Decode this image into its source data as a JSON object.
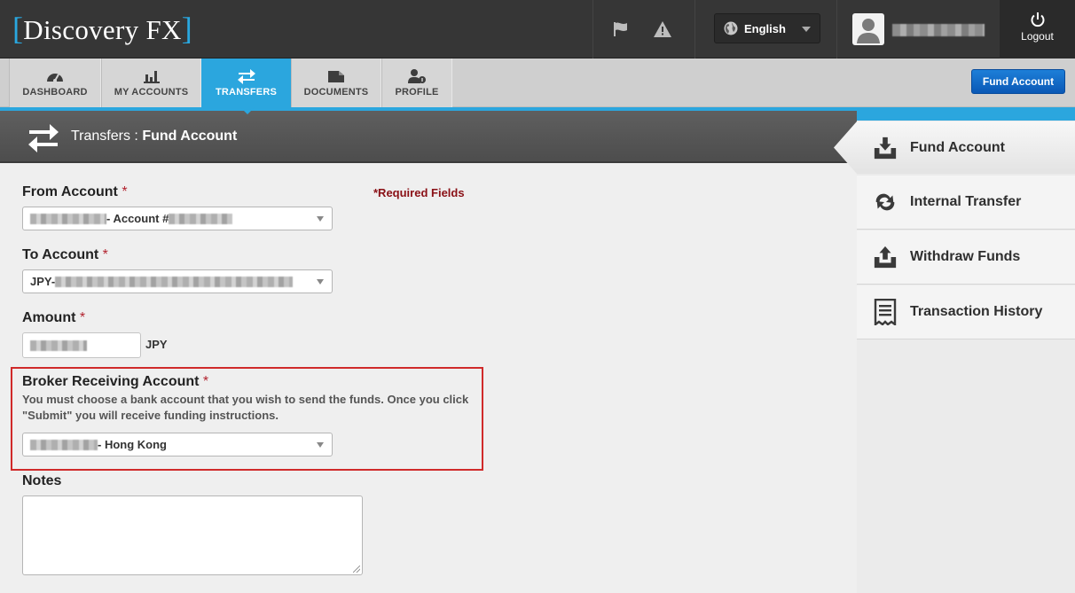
{
  "header": {
    "logo_text": "Discovery FX",
    "language": "English",
    "logout_label": "Logout"
  },
  "nav": {
    "tabs": [
      {
        "label": "DASHBOARD",
        "icon": "dashboard-gauge-icon"
      },
      {
        "label": "MY ACCOUNTS",
        "icon": "bar-chart-icon"
      },
      {
        "label": "TRANSFERS",
        "icon": "transfer-arrows-icon",
        "active": true
      },
      {
        "label": "DOCUMENTS",
        "icon": "folder-icon"
      },
      {
        "label": "PROFILE",
        "icon": "user-profile-icon"
      }
    ],
    "fund_account_button": "Fund Account"
  },
  "page": {
    "breadcrumb_section": "Transfers",
    "breadcrumb_separator": " : ",
    "breadcrumb_page": "Fund Account"
  },
  "form": {
    "required_note": "*Required Fields",
    "from_account_label": "From Account",
    "from_account_value": "- Account #",
    "to_account_label": "To Account",
    "to_account_value": "JPY-",
    "amount_label": "Amount",
    "amount_currency": "JPY",
    "broker_label": "Broker Receiving Account",
    "broker_hint": "You must choose a bank account that you wish to send the funds. Once you click \"Submit\" you will receive funding instructions.",
    "broker_value": "- Hong Kong",
    "notes_label": "Notes",
    "required_marker": "*"
  },
  "sidebar": {
    "items": [
      {
        "label": "Fund Account",
        "icon": "fund-download-icon",
        "active": true
      },
      {
        "label": "Internal Transfer",
        "icon": "exchange-arrows-icon"
      },
      {
        "label": "Withdraw Funds",
        "icon": "withdraw-upload-icon"
      },
      {
        "label": "Transaction History",
        "icon": "receipt-icon"
      }
    ]
  },
  "colors": {
    "accent_blue": "#2ba6de",
    "header_dark": "#363636",
    "required_red": "#b2232f",
    "highlight_red": "#d02a2a",
    "button_blue": "#0a58b6"
  }
}
